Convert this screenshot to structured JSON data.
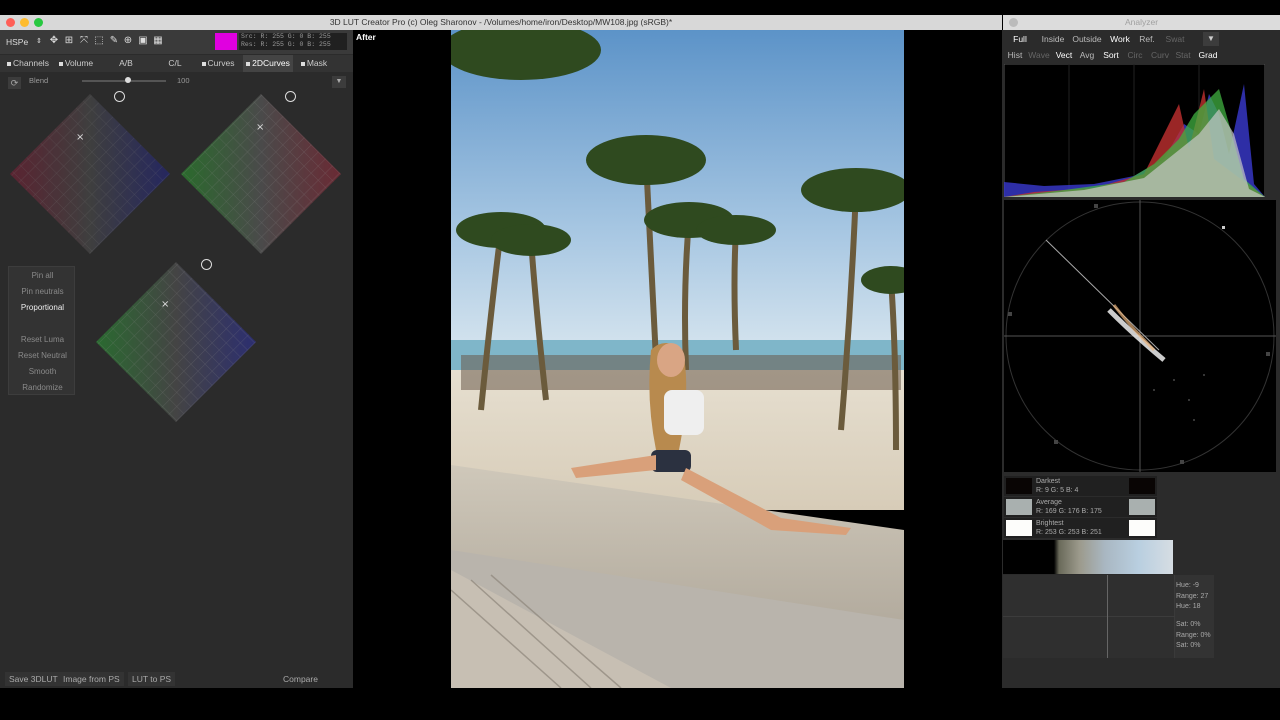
{
  "window": {
    "title": "3D LUT Creator Pro (c) Oleg Sharonov - /Volumes/home/iron/Desktop/MW108.jpg (sRGB)*",
    "analyzer_title": "Analyzer",
    "traffic_colors": [
      "#ff5f57",
      "#febc2e",
      "#28c840"
    ]
  },
  "toolbar": {
    "color_space": "HSPe",
    "src_line": "Src: R: 255  G:    0   B: 255",
    "res_line": "Res: R: 255  G:    0   B: 255",
    "swatch_color": "#e000e0",
    "icons": [
      "move-icon",
      "fit-icon",
      "crop-icon",
      "select-icon",
      "eyedropper-icon",
      "zoom-icon",
      "frame-icon",
      "grid-icon"
    ]
  },
  "tabs": [
    {
      "label": "Channels",
      "dot": true,
      "active": false
    },
    {
      "label": "Volume",
      "dot": true,
      "active": false
    },
    {
      "label": "A/B",
      "dot": false,
      "active": false
    },
    {
      "label": "C/L",
      "dot": false,
      "active": false
    },
    {
      "label": "Curves",
      "dot": true,
      "active": false
    },
    {
      "label": "2DCurves",
      "dot": true,
      "active": true
    },
    {
      "label": "Mask",
      "dot": true,
      "active": false
    }
  ],
  "blend": {
    "label": "Blend",
    "value": "100",
    "level": 0.55
  },
  "side_buttons": [
    {
      "label": "Pin all",
      "on": false
    },
    {
      "label": "Pin neutrals",
      "on": false
    },
    {
      "label": "Proportional",
      "on": true
    },
    {
      "label": "Reset Luma",
      "on": false
    },
    {
      "label": "Reset Neutral",
      "on": false
    },
    {
      "label": "Smooth",
      "on": false
    },
    {
      "label": "Randomize",
      "on": false
    }
  ],
  "bottom": {
    "save": "Save 3DLUT",
    "image_from_ps": "Image from PS",
    "lut_to_ps": "LUT to PS",
    "compare": "Compare"
  },
  "viewer": {
    "label": "After"
  },
  "analyzer": {
    "row1": [
      {
        "label": "Full",
        "state": "on"
      },
      {
        "label": "Inside",
        "state": "normal"
      },
      {
        "label": "Outside",
        "state": "normal"
      },
      {
        "label": "Work",
        "state": "on"
      },
      {
        "label": "Ref.",
        "state": "normal"
      },
      {
        "label": "Swat",
        "state": "dim"
      }
    ],
    "row2": [
      {
        "label": "Hist",
        "state": "normal"
      },
      {
        "label": "Wave",
        "state": "dim"
      },
      {
        "label": "Vect",
        "state": "on"
      },
      {
        "label": "Avg",
        "state": "normal"
      },
      {
        "label": "Sort",
        "state": "on"
      },
      {
        "label": "Circ",
        "state": "dim"
      },
      {
        "label": "Curv",
        "state": "dim"
      },
      {
        "label": "Stat",
        "state": "dim"
      },
      {
        "label": "Grad",
        "state": "on"
      }
    ],
    "stats": [
      {
        "name": "Darkest",
        "values": "R:  9    G:   5    B:   4",
        "color": "#090504"
      },
      {
        "name": "Average",
        "values": "R: 169   G: 176   B: 175",
        "color": "#a9b0af"
      },
      {
        "name": "Brightest",
        "values": "R: 253   G: 253   B: 251",
        "color": "#fdfdfb"
      }
    ],
    "hue": {
      "hue1": "Hue: -9",
      "range1": "Range: 27",
      "hue2": "Hue: 18",
      "sat1": "Sat: 0%",
      "range2": "Range: 0%",
      "sat2": "Sat: 0%"
    }
  }
}
